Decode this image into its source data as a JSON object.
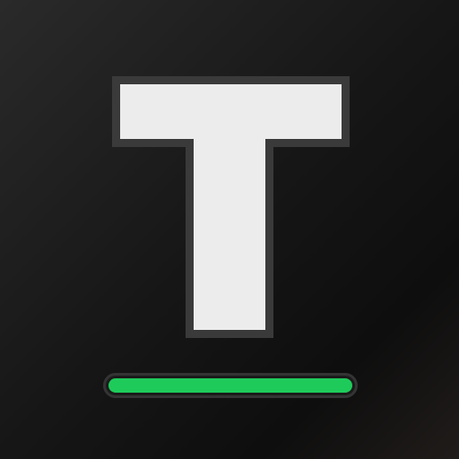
{
  "logo": {
    "letter": "T",
    "glyph_color": "#ececec",
    "outline_color": "#3a3a3a"
  },
  "accent_bar": {
    "color": "#1ecb5a",
    "level": 1.0
  }
}
